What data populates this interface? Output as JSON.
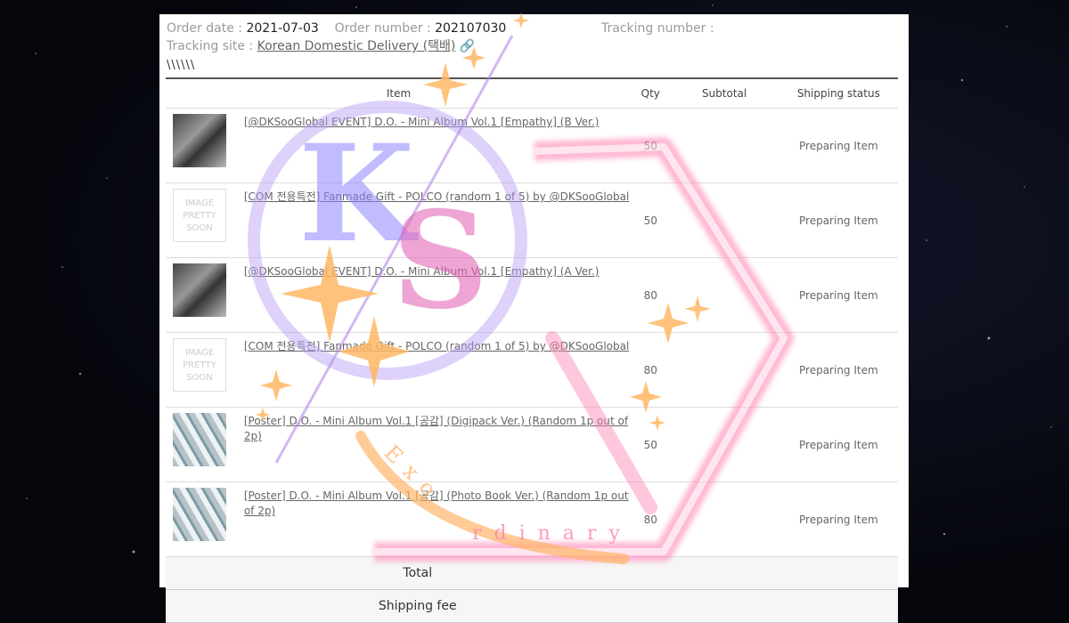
{
  "header": {
    "order_date_label": "Order date :",
    "order_date": "2021-07-03",
    "order_number_label": "Order number :",
    "order_number": "202107030",
    "tracking_number_label": "Tracking number :",
    "tracking_site_label": "Tracking site :",
    "tracking_site": "Korean Domestic Delivery (택배)",
    "slashes": "\\\\\\\\\\\\"
  },
  "table": {
    "columns": [
      "Item",
      "Qty",
      "Subtotal",
      "Shipping status"
    ],
    "rows": [
      {
        "name": "[@DKSooGlobal EVENT] D.O. - Mini Album Vol.1 [Empathy] (B Ver.)",
        "qty": "50",
        "status": "Preparing Item",
        "thumb": "photo"
      },
      {
        "name": "[COM 전용특전] Fanmade Gift - POLCO (random 1 of 5) by @DKSooGlobal",
        "qty": "50",
        "status": "Preparing Item",
        "thumb": "placeholder"
      },
      {
        "name": "[@DKSooGlobal EVENT] D.O. - Mini Album Vol.1 [Empathy] (A Ver.)",
        "qty": "80",
        "status": "Preparing Item",
        "thumb": "photo"
      },
      {
        "name": "[COM 전용특전] Fanmade Gift - POLCO (random 1 of 5) by @DKSooGlobal",
        "qty": "80",
        "status": "Preparing Item",
        "thumb": "placeholder"
      },
      {
        "name": "[Poster] D.O. - Mini Album Vol.1 [공감] (Digipack Ver.) (Random 1p out of 2p)",
        "qty": "50",
        "status": "Preparing Item",
        "thumb": "poster"
      },
      {
        "name": "[Poster] D.O. - Mini Album Vol.1 [공감] (Photo Book Ver.) (Random 1p out of 2p)",
        "qty": "80",
        "status": "Preparing Item",
        "thumb": "poster"
      }
    ],
    "placeholder_text": [
      "IMAGE",
      "PRETTY",
      "SOON"
    ],
    "total_label": "Total",
    "shipping_fee_label": "Shipping fee"
  },
  "watermark": {
    "letters_k": "K",
    "letters_s": "S",
    "word_exo": "Exo",
    "word_rdinary": "rdinary",
    "colors": {
      "purple": "#8e86ff",
      "pink": "#ff7fb0",
      "orange": "#ffb56a"
    }
  },
  "icons": {
    "link": "link-icon",
    "sparkle": "sparkle-icon"
  }
}
